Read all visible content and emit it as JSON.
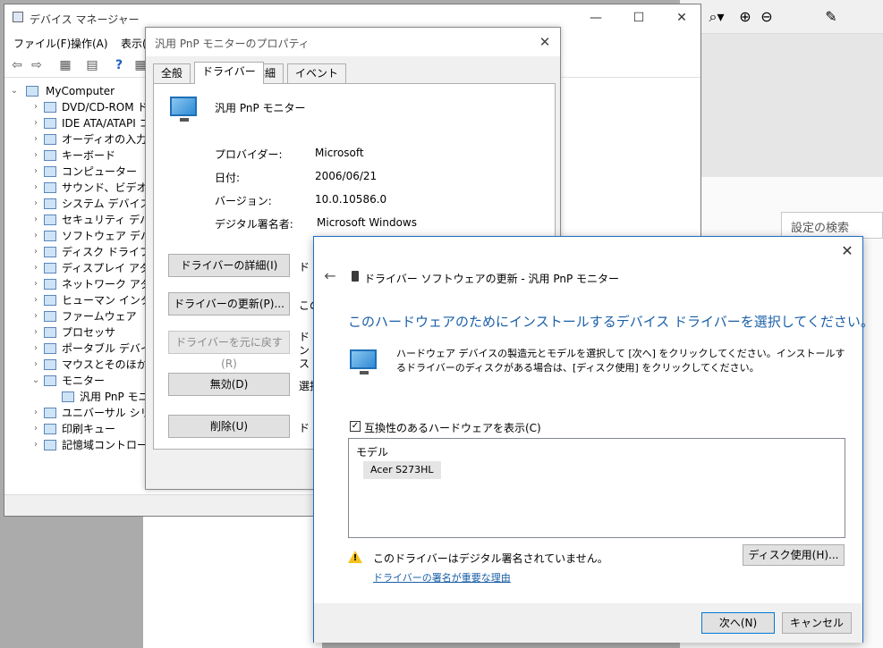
{
  "background_app": {
    "toolbar_icons": [
      "zoom-dropdown-icon",
      "zoom-in-icon",
      "zoom-out-icon",
      "eyedropper-icon"
    ],
    "search_placeholder": "設定の検索"
  },
  "device_manager": {
    "title": "デバイス マネージャー",
    "menu": [
      "ファイル(F)",
      "操作(A)",
      "表示(V)"
    ],
    "tree_root": "MyComputer",
    "tree_items": [
      "DVD/CD-ROM ドライブ",
      "IDE ATA/ATAPI コントローラー",
      "オーディオの入力および出力",
      "キーボード",
      "コンピューター",
      "サウンド、ビデオ、およびゲーム コントローラー",
      "システム デバイス",
      "セキュリティ デバイス",
      "ソフトウェア デバイス",
      "ディスク ドライブ",
      "ディスプレイ アダプター",
      "ネットワーク アダプター",
      "ヒューマン インターフェイス デバイス",
      "ファームウェア",
      "プロセッサ",
      "ポータブル デバイス",
      "マウスとそのほかのポインティング デバイス",
      "モニター",
      "汎用 PnP モニター",
      "ユニバーサル シリアル バス コントローラー",
      "印刷キュー",
      "記憶域コントローラー"
    ]
  },
  "properties": {
    "title": "汎用 PnP モニターのプロパティ",
    "tabs": [
      "全般",
      "ドライバー",
      "詳細",
      "イベント"
    ],
    "device_name": "汎用 PnP モニター",
    "fields": [
      {
        "label": "プロバイダー:",
        "value": "Microsoft"
      },
      {
        "label": "日付:",
        "value": "2006/06/21"
      },
      {
        "label": "バージョン:",
        "value": "10.0.10586.0"
      },
      {
        "label": "デジタル署名者:",
        "value": "Microsoft Windows"
      }
    ],
    "buttons": [
      {
        "label": "ドライバーの詳細(I)",
        "side": "ド"
      },
      {
        "label": "ドライバーの更新(P)...",
        "side": "この"
      },
      {
        "label": "ドライバーを元に戻す(R)",
        "side": "ドンス"
      },
      {
        "label": "無効(D)",
        "side": "選択"
      },
      {
        "label": "削除(U)",
        "side": "ド"
      }
    ]
  },
  "update_driver": {
    "subtitle": "ドライバー ソフトウェアの更新 - 汎用 PnP モニター",
    "heading": "このハードウェアのためにインストールするデバイス ドライバーを選択してください。",
    "description": "ハードウェア デバイスの製造元とモデルを選択して [次へ] をクリックしてください。インストールするドライバーのディスクがある場合は、[ディスク使用] をクリックしてください。",
    "checkbox_label": "互換性のあるハードウェアを表示(C)",
    "checkbox_checked": "✓",
    "list_header": "モデル",
    "list_item": "Acer S273HL",
    "warning_mark": "!",
    "warning": "このドライバーはデジタル署名されていません。",
    "link": "ドライバーの署名が重要な理由",
    "disk_button": "ディスク使用(H)...",
    "next_button": "次へ(N)",
    "cancel_button": "キャンセル"
  }
}
